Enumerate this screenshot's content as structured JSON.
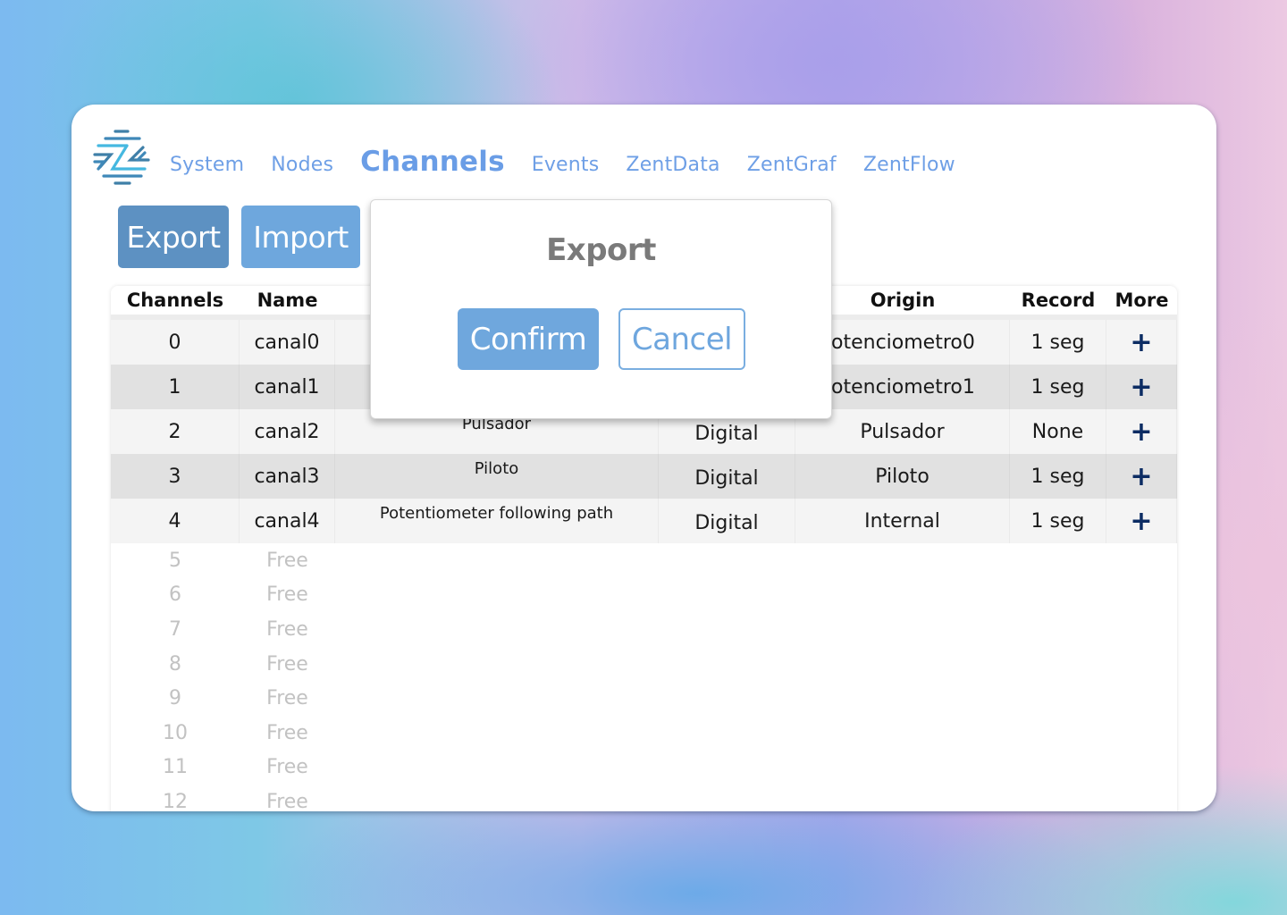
{
  "nav": {
    "items": [
      {
        "label": "System",
        "active": false
      },
      {
        "label": "Nodes",
        "active": false
      },
      {
        "label": "Channels",
        "active": true
      },
      {
        "label": "Events",
        "active": false
      },
      {
        "label": "ZentData",
        "active": false
      },
      {
        "label": "ZentGraf",
        "active": false
      },
      {
        "label": "ZentFlow",
        "active": false
      }
    ],
    "logo_icon": "zent-logo-icon"
  },
  "toolbar": {
    "export_label": "Export",
    "import_label": "Import"
  },
  "table": {
    "headers": {
      "channels": "Channels",
      "name": "Name",
      "origin": "Origin",
      "record": "Record",
      "more": "More"
    },
    "rows": [
      {
        "channel": "0",
        "name": "canal0",
        "description": "",
        "type": "",
        "origin": "otenciometro0",
        "record": "1 seg",
        "more": "+"
      },
      {
        "channel": "1",
        "name": "canal1",
        "description": "",
        "type": "",
        "origin": "otenciometro1",
        "record": "1 seg",
        "more": "+"
      },
      {
        "channel": "2",
        "name": "canal2",
        "description": "Pulsador",
        "type": "Digital",
        "origin": "Pulsador",
        "record": "None",
        "more": "+"
      },
      {
        "channel": "3",
        "name": "canal3",
        "description": "Piloto",
        "type": "Digital",
        "origin": "Piloto",
        "record": "1 seg",
        "more": "+"
      },
      {
        "channel": "4",
        "name": "canal4",
        "description": "Potentiometer following path",
        "type": "Digital",
        "origin": "Internal",
        "record": "1 seg",
        "more": "+"
      }
    ],
    "free_rows": [
      {
        "channel": "5",
        "name": "Free"
      },
      {
        "channel": "6",
        "name": "Free"
      },
      {
        "channel": "7",
        "name": "Free"
      },
      {
        "channel": "8",
        "name": "Free"
      },
      {
        "channel": "9",
        "name": "Free"
      },
      {
        "channel": "10",
        "name": "Free"
      },
      {
        "channel": "11",
        "name": "Free"
      },
      {
        "channel": "12",
        "name": "Free"
      }
    ]
  },
  "modal": {
    "title": "Export",
    "confirm_label": "Confirm",
    "cancel_label": "Cancel"
  },
  "colors": {
    "nav_link": "#6e9fe6",
    "export_button": "#5d91c2",
    "import_button": "#6ea7dd",
    "confirm_button": "#6fa7dd",
    "more_icon": "#0c2c63",
    "free_text": "#c2c2c2"
  }
}
